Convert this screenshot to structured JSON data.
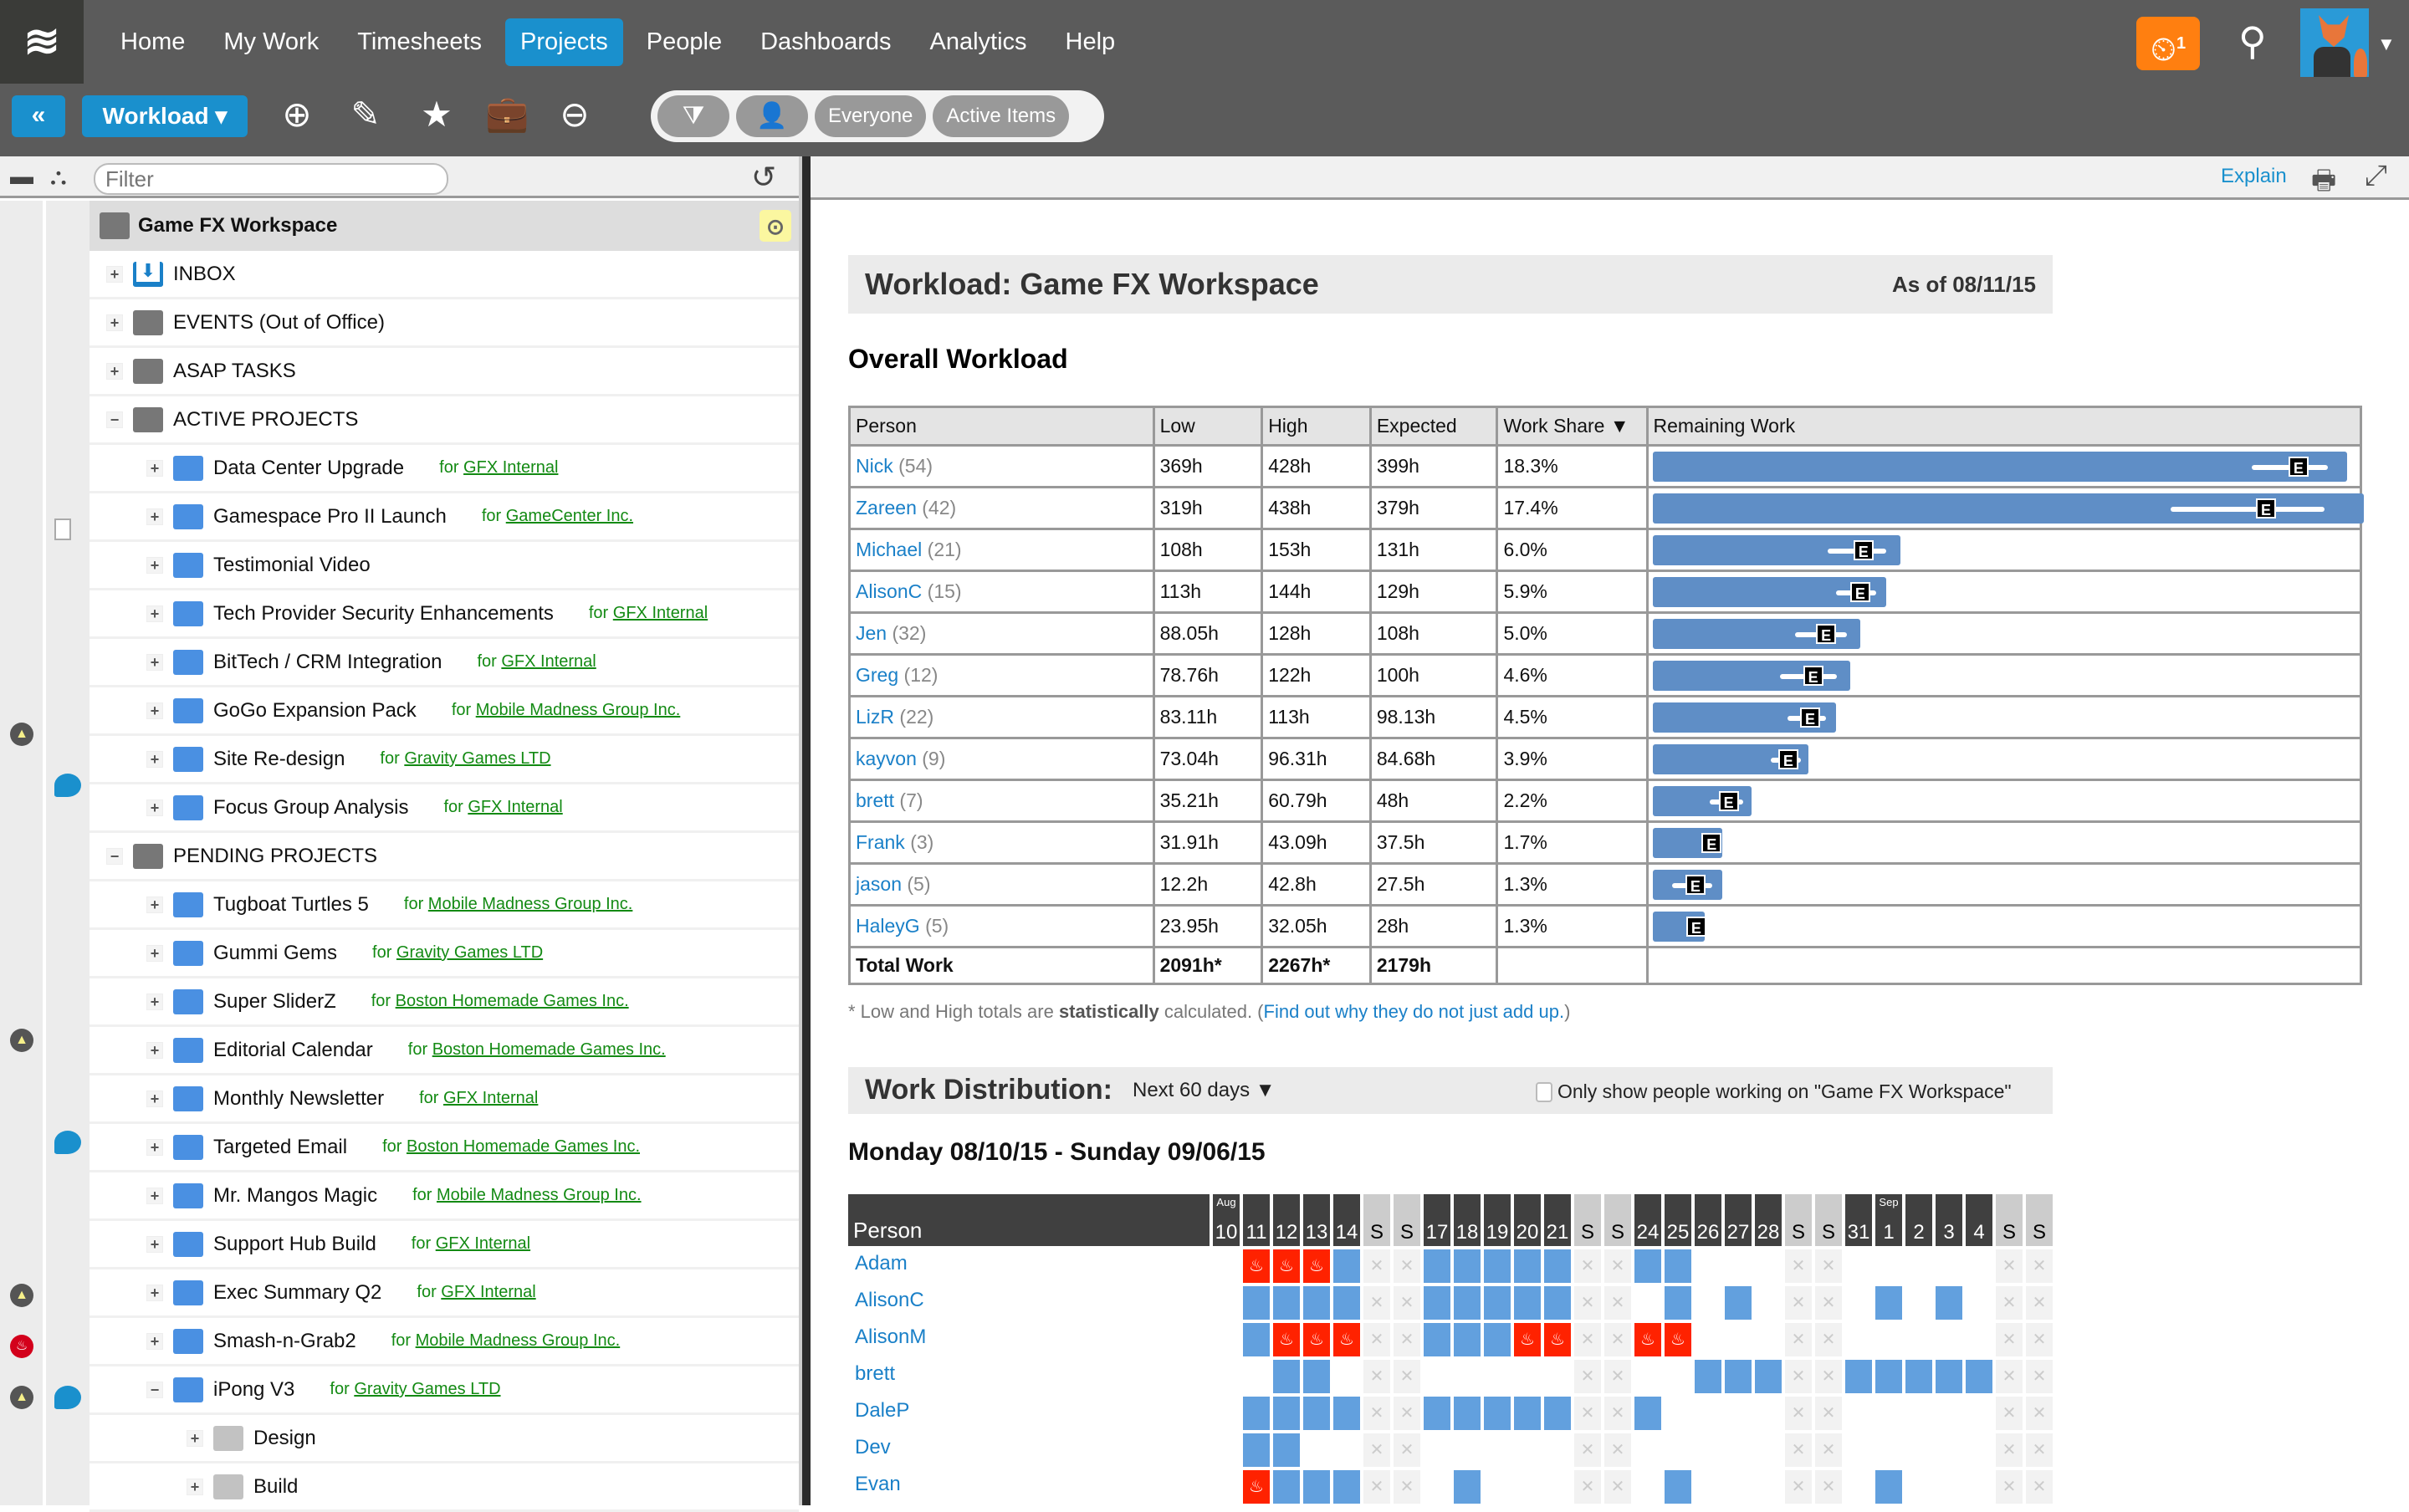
{
  "topnav": {
    "logo": "≋",
    "items": [
      {
        "label": "Home",
        "active": false
      },
      {
        "label": "My Work",
        "active": false
      },
      {
        "label": "Timesheets",
        "active": false
      },
      {
        "label": "Projects",
        "active": true
      },
      {
        "label": "People",
        "active": false
      },
      {
        "label": "Dashboards",
        "active": false
      },
      {
        "label": "Analytics",
        "active": false
      },
      {
        "label": "Help",
        "active": false
      }
    ],
    "timer_count": "1",
    "timer_icon": "⏲",
    "search_icon": "⚲",
    "avatar_caret": "▼"
  },
  "toolbar": {
    "collapse_label": "«",
    "view_label": "Workload ▾",
    "icons": [
      "⊕",
      "✎",
      "★",
      "💼",
      "⊖"
    ],
    "filter_pills": {
      "filter_icon": "⧩",
      "person_icon": "👤",
      "everyone": "Everyone",
      "active_items": "Active Items"
    }
  },
  "left": {
    "filter_placeholder": "Filter",
    "refresh_icon": "↺",
    "root": {
      "label": "Game FX Workspace",
      "badge": "⊙"
    },
    "rows": [
      {
        "label": "INBOX",
        "level": 1,
        "toggle": "+",
        "icon": "inbox",
        "client": "",
        "g1": "",
        "g2": ""
      },
      {
        "label": "EVENTS (Out of Office)",
        "level": 1,
        "toggle": "+",
        "icon": "package",
        "client": "",
        "g1": "",
        "g2": ""
      },
      {
        "label": "ASAP TASKS",
        "level": 1,
        "toggle": "+",
        "icon": "package",
        "client": "",
        "g1": "",
        "g2": ""
      },
      {
        "label": "ACTIVE PROJECTS",
        "level": 1,
        "toggle": "−",
        "icon": "package",
        "client": "",
        "g1": "",
        "g2": ""
      },
      {
        "label": "Data Center Upgrade",
        "level": 2,
        "toggle": "+",
        "icon": "folder",
        "client": "GFX Internal",
        "g1": "",
        "g2": ""
      },
      {
        "label": "Gamespace Pro II Launch",
        "level": 2,
        "toggle": "+",
        "icon": "folder",
        "client": "GameCenter Inc.",
        "g1": "",
        "g2": "doc"
      },
      {
        "label": "Testimonial Video",
        "level": 2,
        "toggle": "+",
        "icon": "folder",
        "client": "",
        "g1": "",
        "g2": ""
      },
      {
        "label": "Tech Provider Security Enhancements",
        "level": 2,
        "toggle": "+",
        "icon": "folder",
        "client": "GFX Internal",
        "g1": "",
        "g2": ""
      },
      {
        "label": "BitTech / CRM Integration",
        "level": 2,
        "toggle": "+",
        "icon": "folder",
        "client": "GFX Internal",
        "g1": "",
        "g2": ""
      },
      {
        "label": "GoGo Expansion Pack",
        "level": 2,
        "toggle": "+",
        "icon": "folder",
        "client": "Mobile Madness Group Inc.",
        "g1": "warn",
        "g2": ""
      },
      {
        "label": "Site Re-design",
        "level": 2,
        "toggle": "+",
        "icon": "folder",
        "client": "Gravity Games LTD",
        "g1": "",
        "g2": "comment-doc"
      },
      {
        "label": "Focus Group Analysis",
        "level": 2,
        "toggle": "+",
        "icon": "folder",
        "client": "GFX Internal",
        "g1": "",
        "g2": ""
      },
      {
        "label": "PENDING PROJECTS",
        "level": 1,
        "toggle": "−",
        "icon": "package",
        "client": "",
        "g1": "",
        "g2": ""
      },
      {
        "label": "Tugboat Turtles 5",
        "level": 2,
        "toggle": "+",
        "icon": "folder",
        "client": "Mobile Madness Group Inc.",
        "g1": "",
        "g2": ""
      },
      {
        "label": "Gummi Gems",
        "level": 2,
        "toggle": "+",
        "icon": "folder",
        "client": "Gravity Games LTD",
        "g1": "",
        "g2": ""
      },
      {
        "label": "Super SliderZ",
        "level": 2,
        "toggle": "+",
        "icon": "folder",
        "client": "Boston Homemade Games Inc.",
        "g1": "warn",
        "g2": ""
      },
      {
        "label": "Editorial Calendar",
        "level": 2,
        "toggle": "+",
        "icon": "folder",
        "client": "Boston Homemade Games Inc.",
        "g1": "",
        "g2": ""
      },
      {
        "label": "Monthly Newsletter",
        "level": 2,
        "toggle": "+",
        "icon": "folder",
        "client": "GFX Internal",
        "g1": "",
        "g2": "comment-doc"
      },
      {
        "label": "Targeted Email",
        "level": 2,
        "toggle": "+",
        "icon": "folder",
        "client": "Boston Homemade Games Inc.",
        "g1": "",
        "g2": ""
      },
      {
        "label": "Mr. Mangos Magic",
        "level": 2,
        "toggle": "+",
        "icon": "folder",
        "client": "Mobile Madness Group Inc.",
        "g1": "",
        "g2": ""
      },
      {
        "label": "Support Hub Build",
        "level": 2,
        "toggle": "+",
        "icon": "folder",
        "client": "GFX Internal",
        "g1": "warn",
        "g2": ""
      },
      {
        "label": "Exec Summary Q2",
        "level": 2,
        "toggle": "+",
        "icon": "folder",
        "client": "GFX Internal",
        "g1": "fire",
        "g2": ""
      },
      {
        "label": "Smash-n-Grab2",
        "level": 2,
        "toggle": "+",
        "icon": "folder",
        "client": "Mobile Madness Group Inc.",
        "g1": "warn",
        "g2": "comment"
      },
      {
        "label": "iPong V3",
        "level": 2,
        "toggle": "−",
        "icon": "folder",
        "client": "Gravity Games LTD",
        "g1": "",
        "g2": ""
      },
      {
        "label": "Design",
        "level": 3,
        "toggle": "+",
        "icon": "folder-gray",
        "client": "",
        "g1": "",
        "g2": ""
      },
      {
        "label": "Build",
        "level": 3,
        "toggle": "+",
        "icon": "folder-gray",
        "client": "",
        "g1": "",
        "g2": ""
      }
    ],
    "client_prefix": "for"
  },
  "right": {
    "explain": "Explain",
    "print_icon": "🖶",
    "expand_icon": "⤢",
    "title": "Workload: Game FX Workspace",
    "as_of": "As of 08/11/15",
    "overall_title": "Overall Workload",
    "table": {
      "headers": [
        "Person",
        "Low",
        "High",
        "Expected",
        "Work Share ▼",
        "Remaining Work"
      ],
      "rows": [
        {
          "name": "Nick",
          "count": "(54)",
          "low": "369h",
          "high": "428h",
          "expected": "399h",
          "share": "18.3%"
        },
        {
          "name": "Zareen",
          "count": "(42)",
          "low": "319h",
          "high": "438h",
          "expected": "379h",
          "share": "17.4%"
        },
        {
          "name": "Michael",
          "count": "(21)",
          "low": "108h",
          "high": "153h",
          "expected": "131h",
          "share": "6.0%"
        },
        {
          "name": "AlisonC",
          "count": "(15)",
          "low": "113h",
          "high": "144h",
          "expected": "129h",
          "share": "5.9%"
        },
        {
          "name": "Jen",
          "count": "(32)",
          "low": "88.05h",
          "high": "128h",
          "expected": "108h",
          "share": "5.0%"
        },
        {
          "name": "Greg",
          "count": "(12)",
          "low": "78.76h",
          "high": "122h",
          "expected": "100h",
          "share": "4.6%"
        },
        {
          "name": "LizR",
          "count": "(22)",
          "low": "83.11h",
          "high": "113h",
          "expected": "98.13h",
          "share": "4.5%"
        },
        {
          "name": "kayvon",
          "count": "(9)",
          "low": "73.04h",
          "high": "96.31h",
          "expected": "84.68h",
          "share": "3.9%"
        },
        {
          "name": "brett",
          "count": "(7)",
          "low": "35.21h",
          "high": "60.79h",
          "expected": "48h",
          "share": "2.2%"
        },
        {
          "name": "Frank",
          "count": "(3)",
          "low": "31.91h",
          "high": "43.09h",
          "expected": "37.5h",
          "share": "1.7%"
        },
        {
          "name": "jason",
          "count": "(5)",
          "low": "12.2h",
          "high": "42.8h",
          "expected": "27.5h",
          "share": "1.3%"
        },
        {
          "name": "HaleyG",
          "count": "(5)",
          "low": "23.95h",
          "high": "32.05h",
          "expected": "28h",
          "share": "1.3%"
        }
      ],
      "total": {
        "label": "Total Work",
        "low": "2091h*",
        "high": "2267h*",
        "expected": "2179h"
      },
      "bar_marker": "E",
      "bar_values": [
        {
          "low": 369,
          "high": 428,
          "expected": 399
        },
        {
          "low": 319,
          "high": 438,
          "expected": 379
        },
        {
          "low": 108,
          "high": 153,
          "expected": 131
        },
        {
          "low": 113,
          "high": 144,
          "expected": 129
        },
        {
          "low": 88.05,
          "high": 128,
          "expected": 108
        },
        {
          "low": 78.76,
          "high": 122,
          "expected": 100
        },
        {
          "low": 83.11,
          "high": 113,
          "expected": 98.13
        },
        {
          "low": 73.04,
          "high": 96.31,
          "expected": 84.68
        },
        {
          "low": 35.21,
          "high": 60.79,
          "expected": 48
        },
        {
          "low": 31.91,
          "high": 43.09,
          "expected": 37.5
        },
        {
          "low": 12.2,
          "high": 42.8,
          "expected": 27.5
        },
        {
          "low": 23.95,
          "high": 32.05,
          "expected": 28
        }
      ],
      "bar_max": 438
    },
    "footnote": {
      "pre": "* Low and High totals are ",
      "bold": "statistically",
      "mid": " calculated. (",
      "link": "Find out why they do not just add up.",
      "post": ")"
    },
    "distribution": {
      "title": "Work Distribution:",
      "range_select": "Next 60 days ▼",
      "checkbox_label": "Only show people working on \"Game FX Workspace\"",
      "date_range": "Monday 08/10/15 - Sunday 09/06/15",
      "person_header": "Person",
      "days": [
        {
          "num": "10",
          "mon": "Aug",
          "we": false
        },
        {
          "num": "11",
          "mon": "",
          "we": false
        },
        {
          "num": "12",
          "mon": "",
          "we": false
        },
        {
          "num": "13",
          "mon": "",
          "we": false
        },
        {
          "num": "14",
          "mon": "",
          "we": false
        },
        {
          "num": "S",
          "mon": "",
          "we": true
        },
        {
          "num": "S",
          "mon": "",
          "we": true
        },
        {
          "num": "17",
          "mon": "",
          "we": false
        },
        {
          "num": "18",
          "mon": "",
          "we": false
        },
        {
          "num": "19",
          "mon": "",
          "we": false
        },
        {
          "num": "20",
          "mon": "",
          "we": false
        },
        {
          "num": "21",
          "mon": "",
          "we": false
        },
        {
          "num": "S",
          "mon": "",
          "we": true
        },
        {
          "num": "S",
          "mon": "",
          "we": true
        },
        {
          "num": "24",
          "mon": "",
          "we": false
        },
        {
          "num": "25",
          "mon": "",
          "we": false
        },
        {
          "num": "26",
          "mon": "",
          "we": false
        },
        {
          "num": "27",
          "mon": "",
          "we": false
        },
        {
          "num": "28",
          "mon": "",
          "we": false
        },
        {
          "num": "S",
          "mon": "",
          "we": true
        },
        {
          "num": "S",
          "mon": "",
          "we": true
        },
        {
          "num": "31",
          "mon": "",
          "we": false
        },
        {
          "num": "1",
          "mon": "Sep",
          "we": false
        },
        {
          "num": "2",
          "mon": "",
          "we": false
        },
        {
          "num": "3",
          "mon": "",
          "we": false
        },
        {
          "num": "4",
          "mon": "",
          "we": false
        },
        {
          "num": "S",
          "mon": "",
          "we": true
        },
        {
          "num": "S",
          "mon": "",
          "we": true
        }
      ],
      "legend": {
        "B": "scheduled",
        "R": "overloaded",
        "X": "weekend-off",
        ".": "free"
      },
      "people": [
        {
          "name": "Adam",
          "cells": ".RRRBXXBBBBBXXBB...XX.....XX"
        },
        {
          "name": "AlisonC",
          "cells": ".BBBBXXBBBBBXX.B.B.XX.B.B.XX"
        },
        {
          "name": "AlisonM",
          "cells": ".BRRRXXBBBRRXXRR...XX.....XX"
        },
        {
          "name": "brett",
          "cells": "..BB.XX.....XX..BBBXXBBBBBXX"
        },
        {
          "name": "DaleP",
          "cells": ".BBBBXXBBBBBXXB....XX.....XX"
        },
        {
          "name": "Dev",
          "cells": ".BB..XX.....XX.....XX.....XX"
        },
        {
          "name": "Evan",
          "cells": ".RBBBXX.B...XX.B...XX.B...XX"
        }
      ],
      "overload_icon": "🔥",
      "off_icon": "✕"
    }
  }
}
